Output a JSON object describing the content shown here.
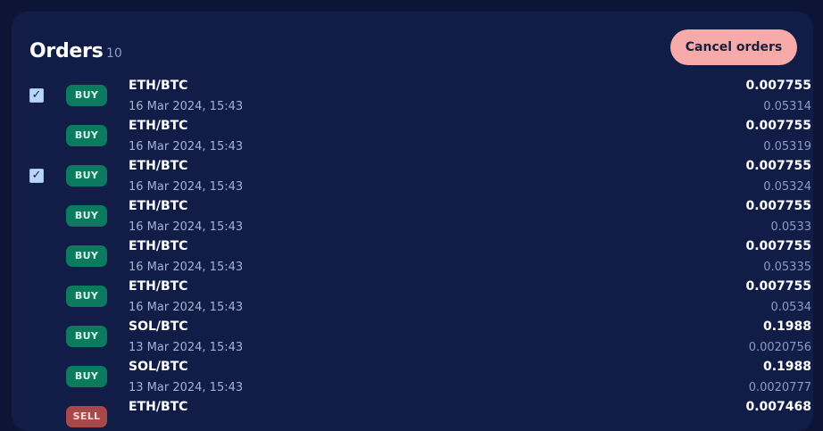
{
  "header": {
    "title": "Orders",
    "count": "10",
    "cancel_label": "Cancel orders"
  },
  "colors": {
    "buy": "#0b7a5e",
    "sell": "#a84848"
  },
  "orders": [
    {
      "checked": true,
      "side": "BUY",
      "pair": "ETH/BTC",
      "date": "16 Mar 2024, 15:43",
      "price": "0.007755",
      "amount": "0.05314"
    },
    {
      "checked": false,
      "side": "BUY",
      "pair": "ETH/BTC",
      "date": "16 Mar 2024, 15:43",
      "price": "0.007755",
      "amount": "0.05319"
    },
    {
      "checked": true,
      "side": "BUY",
      "pair": "ETH/BTC",
      "date": "16 Mar 2024, 15:43",
      "price": "0.007755",
      "amount": "0.05324"
    },
    {
      "checked": false,
      "side": "BUY",
      "pair": "ETH/BTC",
      "date": "16 Mar 2024, 15:43",
      "price": "0.007755",
      "amount": "0.0533"
    },
    {
      "checked": false,
      "side": "BUY",
      "pair": "ETH/BTC",
      "date": "16 Mar 2024, 15:43",
      "price": "0.007755",
      "amount": "0.05335"
    },
    {
      "checked": false,
      "side": "BUY",
      "pair": "ETH/BTC",
      "date": "16 Mar 2024, 15:43",
      "price": "0.007755",
      "amount": "0.0534"
    },
    {
      "checked": false,
      "side": "BUY",
      "pair": "SOL/BTC",
      "date": "13 Mar 2024, 15:43",
      "price": "0.1988",
      "amount": "0.0020756"
    },
    {
      "checked": false,
      "side": "BUY",
      "pair": "SOL/BTC",
      "date": "13 Mar 2024, 15:43",
      "price": "0.1988",
      "amount": "0.0020777"
    },
    {
      "checked": false,
      "side": "SELL",
      "pair": "ETH/BTC",
      "date": "",
      "price": "0.007468",
      "amount": ""
    }
  ]
}
